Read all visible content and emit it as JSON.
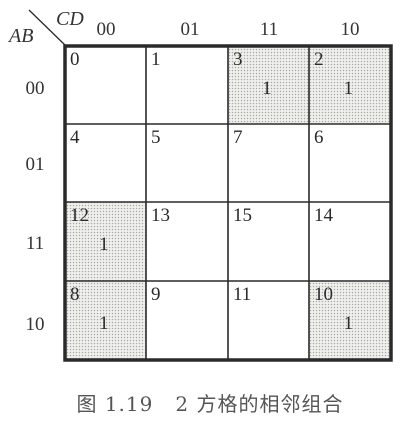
{
  "axes": {
    "row_var": "AB",
    "col_var": "CD"
  },
  "col_codes": [
    "00",
    "01",
    "11",
    "10"
  ],
  "row_codes": [
    "00",
    "01",
    "11",
    "10"
  ],
  "cells": [
    [
      {
        "index": "0",
        "value": "",
        "shaded": false
      },
      {
        "index": "1",
        "value": "",
        "shaded": false
      },
      {
        "index": "3",
        "value": "1",
        "shaded": true
      },
      {
        "index": "2",
        "value": "1",
        "shaded": true
      }
    ],
    [
      {
        "index": "4",
        "value": "",
        "shaded": false
      },
      {
        "index": "5",
        "value": "",
        "shaded": false
      },
      {
        "index": "7",
        "value": "",
        "shaded": false
      },
      {
        "index": "6",
        "value": "",
        "shaded": false
      }
    ],
    [
      {
        "index": "12",
        "value": "1",
        "shaded": true
      },
      {
        "index": "13",
        "value": "",
        "shaded": false
      },
      {
        "index": "15",
        "value": "",
        "shaded": false
      },
      {
        "index": "14",
        "value": "",
        "shaded": false
      }
    ],
    [
      {
        "index": "8",
        "value": "1",
        "shaded": true
      },
      {
        "index": "9",
        "value": "",
        "shaded": false
      },
      {
        "index": "11",
        "value": "",
        "shaded": false
      },
      {
        "index": "10",
        "value": "1",
        "shaded": true
      }
    ]
  ],
  "caption": "图 1.19   2 方格的相邻组合",
  "colors": {
    "shade_bg": "#f0f0ec",
    "shade_dot": "#a8a8a8",
    "line": "#2a2a2a"
  }
}
